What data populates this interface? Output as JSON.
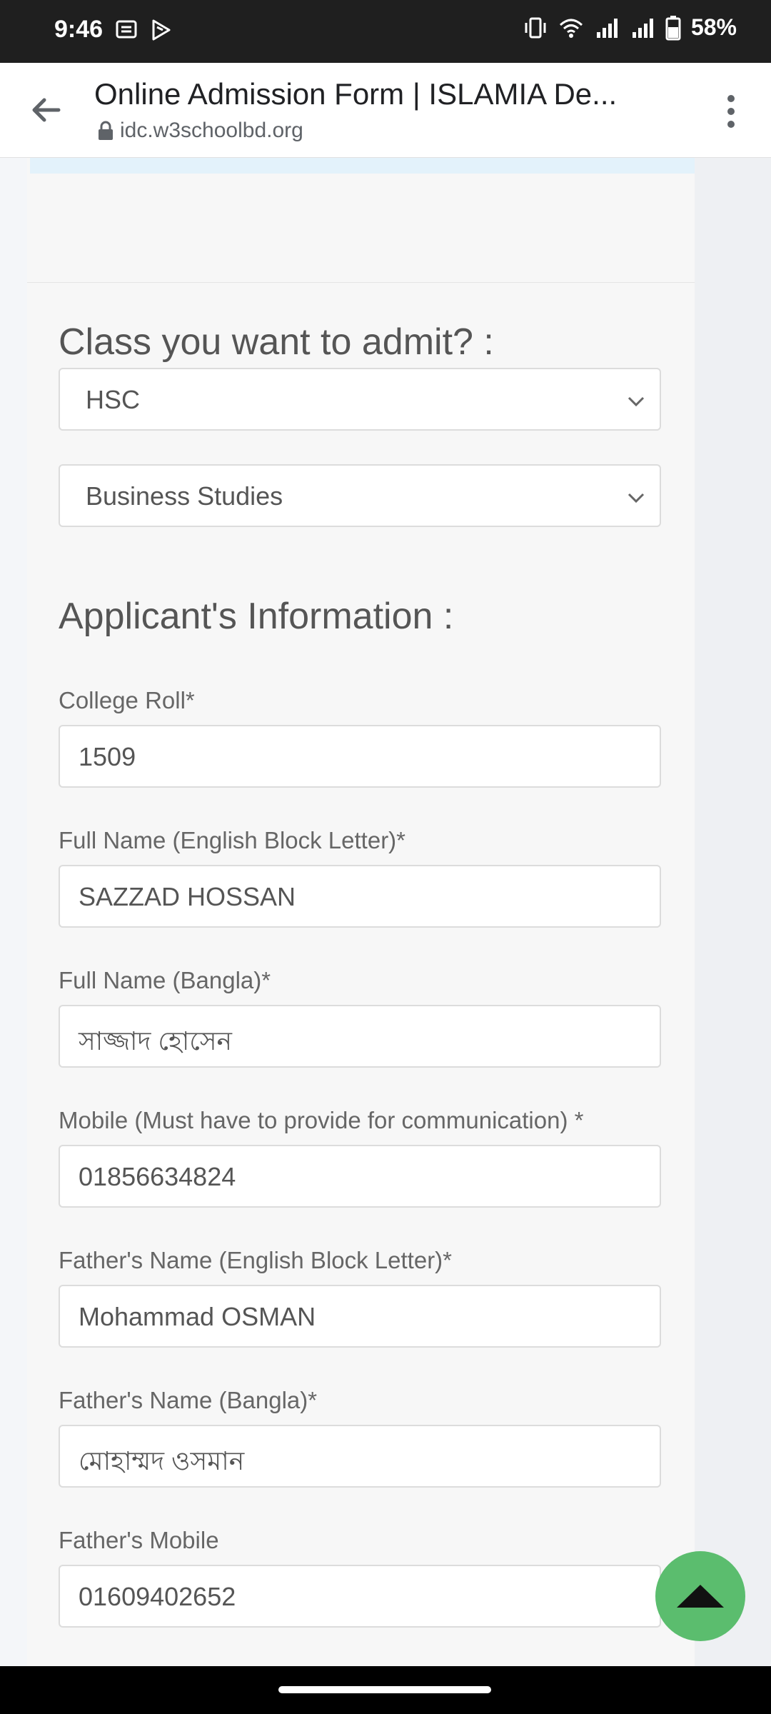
{
  "status_bar": {
    "time": "9:46",
    "battery": "58%",
    "icons": [
      "message-icon",
      "play-icon",
      "vibrate-icon",
      "wifi-icon",
      "signal-icon",
      "signal-icon",
      "battery-icon"
    ]
  },
  "browser": {
    "title": "Online Admission Form | ISLAMIA De...",
    "url": "idc.w3schoolbd.org"
  },
  "form": {
    "class_heading": "Class you want to admit? :",
    "class_select": "HSC",
    "group_select": "Business Studies",
    "applicant_heading": "Applicant's Information :",
    "fields": [
      {
        "label": "College Roll*",
        "value": "1509"
      },
      {
        "label": "Full Name (English Block Letter)*",
        "value": "SAZZAD HOSSAN"
      },
      {
        "label": "Full Name (Bangla)*",
        "value": "সাজ্জাদ হোসেন"
      },
      {
        "label": "Mobile (Must have to provide for communication) *",
        "value": "01856634824"
      },
      {
        "label": "Father's Name (English Block Letter)*",
        "value": "Mohammad OSMAN"
      },
      {
        "label": "Father's Name (Bangla)*",
        "value": "মোহাম্মদ ওসমান"
      },
      {
        "label": "Father's Mobile",
        "value": "01609402652"
      }
    ]
  },
  "colors": {
    "status_bar": "#1f1f1f",
    "scroll_top_fab": "#5bbd6e",
    "info_bar": "#e3f2fb"
  }
}
